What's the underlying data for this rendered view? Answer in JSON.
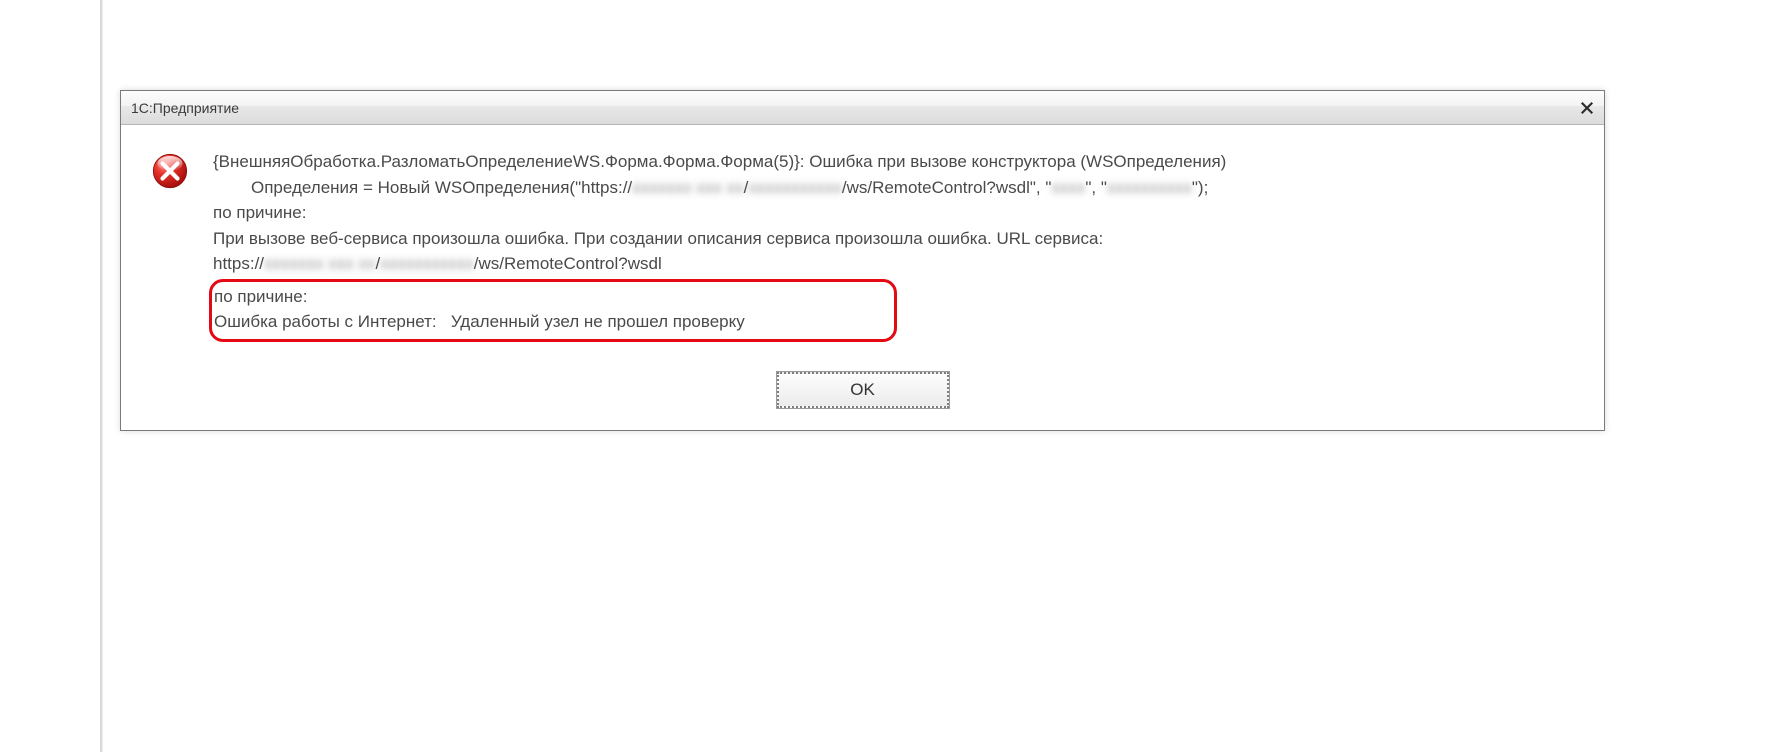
{
  "dialog": {
    "title": "1С:Предприятие",
    "close_label": "✕",
    "ok_label": "OK"
  },
  "message": {
    "line1_pre": "{ВнешняяОбработка.РазломатьОпределениеWS.Форма.Форма.Форма(5)}: Ошибка при вызове конструктора (WSОпределения)",
    "line2_indent": "Определения = Новый WSОпределения(\"https://",
    "line2_blur1": "xxxxxxx xxx xx",
    "line2_mid1": "/",
    "line2_blur2": "xxxxxxxxxxx",
    "line2_mid2": "/ws/RemoteControl?wsdl\", \"",
    "line2_blur3": "xxxx",
    "line2_mid3": "\", \"",
    "line2_blur4": "xxxxxxxxxx",
    "line2_end": "\");",
    "line3": "по причине:",
    "line4_pre": "При вызове веб-сервиса произошла ошибка. При создании описания сервиса произошла ошибка. URL сервиса:",
    "line5_pre": "https://",
    "line5_blur1": "xxxxxxx xxx xx",
    "line5_mid1": "/",
    "line5_blur2": "xxxxxxxxxxx",
    "line5_end": "/ws/RemoteControl?wsdl",
    "highlight_line1": "по причине:",
    "highlight_line2": "Ошибка работы с Интернет:   Удаленный узел не прошел проверку"
  }
}
